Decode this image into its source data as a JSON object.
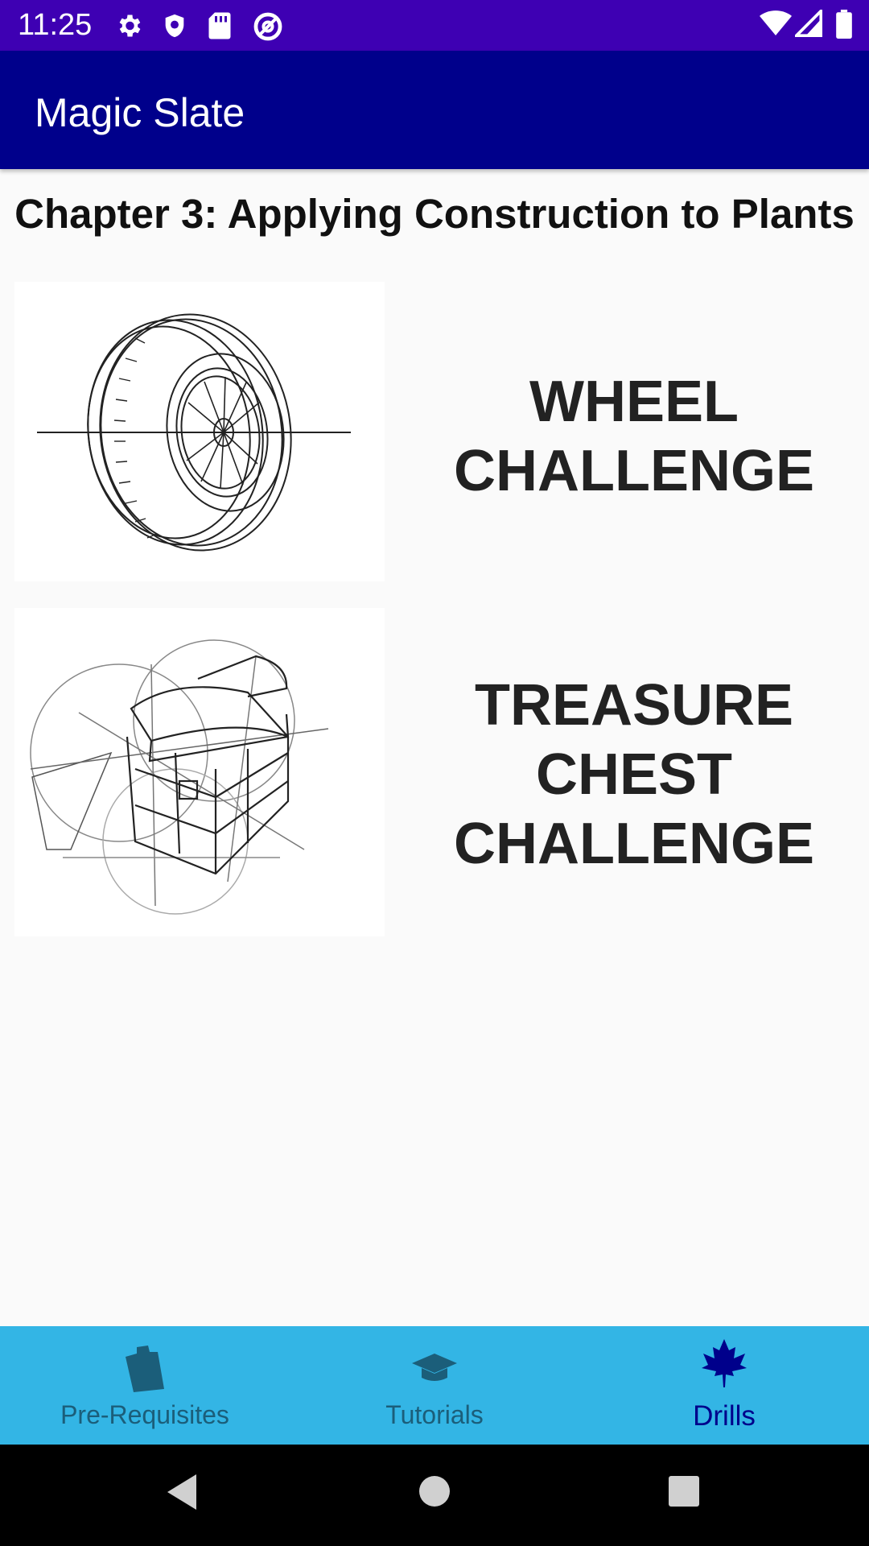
{
  "status_bar": {
    "time": "11:25",
    "left_icons": [
      "gear-icon",
      "shield-icon",
      "sd-card-icon",
      "at-sign-icon"
    ],
    "right_icons": [
      "wifi-icon",
      "cell-signal-icon",
      "battery-icon"
    ]
  },
  "app_bar": {
    "title": "Magic Slate"
  },
  "page": {
    "chapter_title": "Chapter 3: Applying Construction to Plants"
  },
  "drills": [
    {
      "label_lines": [
        "WHEEL",
        "CHALLENGE"
      ],
      "image": "wheel-sketch"
    },
    {
      "label_lines": [
        "TREASURE",
        "CHEST",
        "CHALLENGE"
      ],
      "image": "treasure-chest-sketch"
    }
  ],
  "bottom_nav": {
    "items": [
      {
        "label": "Pre-Requisites",
        "icon": "clipboard-icon",
        "active": false
      },
      {
        "label": "Tutorials",
        "icon": "graduation-cap-icon",
        "active": false
      },
      {
        "label": "Drills",
        "icon": "maple-leaf-icon",
        "active": true
      }
    ],
    "active_color": "#00008b",
    "inactive_color": "#1b5e7a"
  },
  "colors": {
    "status_bar": "#3e00b3",
    "app_bar": "#00008b",
    "bottom_nav": "#33b5e5",
    "background": "#fafafa"
  },
  "system_nav": {
    "buttons": [
      "back-icon",
      "home-icon",
      "recents-icon"
    ]
  }
}
